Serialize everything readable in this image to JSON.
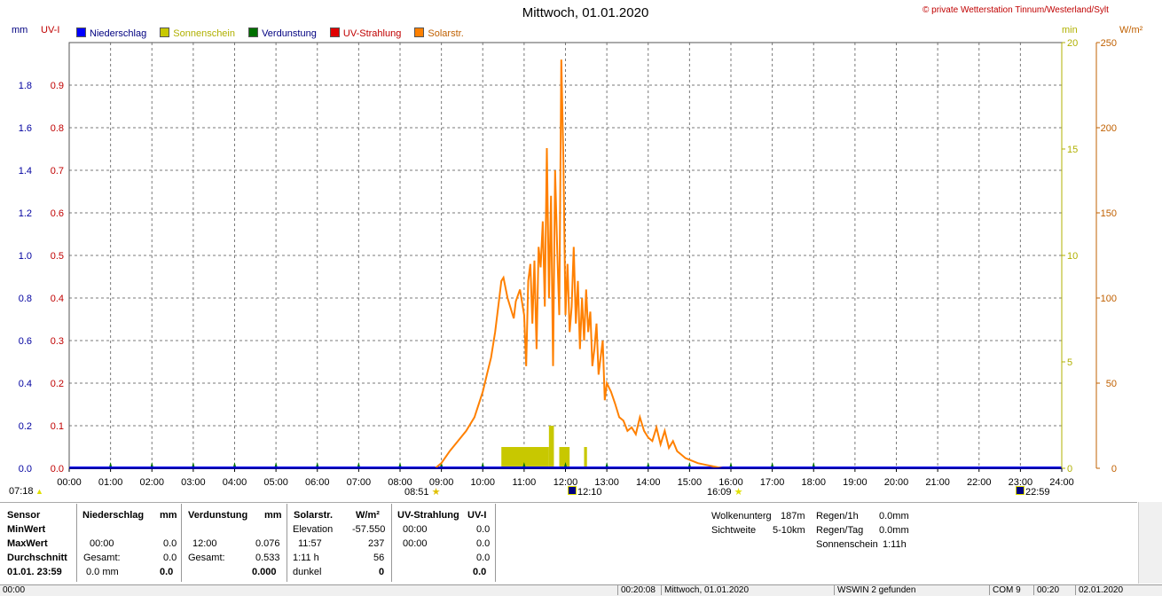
{
  "title": "Mittwoch, 01.01.2020",
  "copyright": "© private Wetterstation Tinnum/Westerland/Sylt",
  "units": {
    "left1": "mm",
    "left2": "UV-I",
    "right1": "min",
    "right2": "W/m²"
  },
  "legend": [
    {
      "label": "Niederschlag",
      "color": "#0000ff",
      "text_color": "#000080"
    },
    {
      "label": "Sonnenschein",
      "color": "#c8c800",
      "text_color": "#b0b000"
    },
    {
      "label": "Verdunstung",
      "color": "#007000",
      "text_color": "#000080"
    },
    {
      "label": "UV-Strahlung",
      "color": "#e00000",
      "text_color": "#c00000"
    },
    {
      "label": "Solarstr.",
      "color": "#ff8000",
      "text_color": "#c06000"
    }
  ],
  "markers": {
    "sunrise": "07:18",
    "sunshine_start": "08:51",
    "solar_noon": "12:10",
    "sunset": "16:09",
    "moon": "22:59"
  },
  "chart_data": {
    "type": "line",
    "x_ticks": [
      "00:00",
      "01:00",
      "02:00",
      "03:00",
      "04:00",
      "05:00",
      "06:00",
      "07:00",
      "08:00",
      "09:00",
      "10:00",
      "11:00",
      "12:00",
      "13:00",
      "14:00",
      "15:00",
      "16:00",
      "17:00",
      "18:00",
      "19:00",
      "20:00",
      "21:00",
      "22:00",
      "23:00",
      "24:00"
    ],
    "axes": {
      "mm": {
        "range": [
          0,
          2.0
        ],
        "ticks": [
          "0.0",
          "0.2",
          "0.4",
          "0.6",
          "0.8",
          "1.0",
          "1.2",
          "1.4",
          "1.6",
          "1.8"
        ],
        "color": "#0000a0"
      },
      "uv": {
        "range": [
          0,
          1.0
        ],
        "ticks": [
          "0.0",
          "0.1",
          "0.2",
          "0.3",
          "0.4",
          "0.5",
          "0.6",
          "0.7",
          "0.8",
          "0.9"
        ],
        "color": "#c00000"
      },
      "min": {
        "range": [
          0,
          20
        ],
        "ticks": [
          "0",
          "5",
          "10",
          "15",
          "20"
        ],
        "color": "#b0b000"
      },
      "wm2": {
        "range": [
          0,
          250
        ],
        "ticks": [
          "0",
          "50",
          "100",
          "150",
          "200",
          "250"
        ],
        "color": "#c06000"
      }
    },
    "grid": true,
    "series": [
      {
        "name": "Solarstr.",
        "axis": "wm2",
        "color": "#ff8000",
        "x": [
          8.85,
          9.0,
          9.2,
          9.4,
          9.6,
          9.8,
          10.0,
          10.1,
          10.2,
          10.3,
          10.4,
          10.45,
          10.5,
          10.6,
          10.7,
          10.75,
          10.8,
          10.9,
          11.0,
          11.05,
          11.1,
          11.15,
          11.2,
          11.25,
          11.3,
          11.35,
          11.4,
          11.45,
          11.5,
          11.55,
          11.6,
          11.65,
          11.7,
          11.75,
          11.8,
          11.85,
          11.9,
          11.95,
          12.0,
          12.05,
          12.1,
          12.15,
          12.2,
          12.25,
          12.3,
          12.35,
          12.4,
          12.45,
          12.5,
          12.55,
          12.6,
          12.65,
          12.7,
          12.75,
          12.8,
          12.85,
          12.9,
          12.95,
          13.0,
          13.1,
          13.2,
          13.3,
          13.4,
          13.5,
          13.6,
          13.7,
          13.8,
          13.9,
          14.0,
          14.1,
          14.2,
          14.3,
          14.4,
          14.5,
          14.6,
          14.7,
          14.8,
          14.9,
          15.0,
          15.2,
          15.4,
          15.6,
          15.8,
          15.9,
          16.0
        ],
        "y": [
          0,
          3,
          10,
          16,
          22,
          30,
          45,
          55,
          65,
          80,
          100,
          110,
          112,
          100,
          92,
          88,
          98,
          105,
          90,
          60,
          110,
          120,
          85,
          122,
          70,
          130,
          118,
          145,
          95,
          188,
          100,
          160,
          60,
          175,
          128,
          90,
          240,
          180,
          90,
          120,
          80,
          95,
          130,
          85,
          110,
          70,
          100,
          75,
          105,
          80,
          92,
          60,
          70,
          85,
          55,
          65,
          75,
          40,
          50,
          45,
          38,
          30,
          28,
          22,
          24,
          20,
          30,
          22,
          18,
          16,
          24,
          14,
          22,
          12,
          16,
          10,
          8,
          6,
          5,
          3,
          2,
          1,
          0,
          0,
          0
        ]
      },
      {
        "name": "Sonnenschein",
        "axis": "min",
        "color": "#c8c800",
        "bars": [
          {
            "x0": 10.45,
            "x1": 11.6,
            "y": 1
          },
          {
            "x0": 11.6,
            "x1": 11.72,
            "y": 2
          },
          {
            "x0": 11.72,
            "x1": 11.85,
            "y": 0
          },
          {
            "x0": 11.85,
            "x1": 12.1,
            "y": 1
          },
          {
            "x0": 12.45,
            "x1": 12.52,
            "y": 1
          }
        ]
      },
      {
        "name": "Verdunstung",
        "axis": "mm",
        "color": "#007000",
        "x": [
          1,
          2,
          3,
          4,
          5,
          6,
          7,
          8,
          9,
          10,
          11,
          12,
          13,
          14,
          15,
          16,
          17,
          18
        ],
        "y": [
          0.076,
          0.076,
          0.076,
          0.076,
          0.076,
          0.076,
          0.076,
          0.076,
          0.076,
          0.076,
          0.076,
          0.076,
          0.076,
          0.076,
          0.076,
          0.076,
          0.076,
          0.076
        ]
      },
      {
        "name": "Niederschlag",
        "axis": "mm",
        "color": "#0000ff",
        "x": [
          0,
          24
        ],
        "y": [
          0,
          0
        ]
      }
    ]
  },
  "stats": {
    "col_sensor": {
      "header": "Sensor",
      "rows": [
        "MinWert",
        "MaxWert",
        "Durchschnitt",
        "01.01. 23:59"
      ]
    },
    "niederschlag": {
      "header": "Niederschlag",
      "unit": "mm",
      "max_time": "00:00",
      "max_val": "0.0",
      "gesamt_label": "Gesamt:",
      "gesamt_val": "0.0",
      "last_a": "0.0 mm",
      "last_b": "0.0"
    },
    "verdunstung": {
      "header": "Verdunstung",
      "unit": "mm",
      "max_time": "12:00",
      "max_val": "0.076",
      "gesamt_label": "Gesamt:",
      "gesamt_val": "0.533",
      "last": "0.000"
    },
    "solar": {
      "header": "Solarstr.",
      "unit": "W/m²",
      "elev_label": "Elevation",
      "elev_val": "-57.550",
      "max_time": "11:57",
      "max_val": "237",
      "dur_label": "1:11 h",
      "dur_val": "56",
      "dark_label": "dunkel",
      "dark_val": "0"
    },
    "uv": {
      "header": "UV-Strahlung",
      "unit": "UV-I",
      "r1_time": "00:00",
      "r1_val": "0.0",
      "r2_time": "00:00",
      "r2_val": "0.0",
      "r3_val": "0.0",
      "r4_val": "0.0"
    },
    "wolken": {
      "label": "Wolkenunterg",
      "val": "187m"
    },
    "sicht": {
      "label": "Sichtweite",
      "val": "5-10km"
    },
    "regen1h": {
      "label": "Regen/1h",
      "val": "0.0mm"
    },
    "regentag": {
      "label": "Regen/Tag",
      "val": "0.0mm"
    },
    "sonnenschein": {
      "label": "Sonnenschein",
      "val": "1:11h"
    }
  },
  "statusbar": {
    "left": "00:00",
    "time": "00:20:08",
    "date": "Mittwoch, 01.01.2020",
    "wswin": "WSWIN 2 gefunden",
    "com": "COM 9",
    "t2": "00:20",
    "d2": "02.01.2020"
  }
}
